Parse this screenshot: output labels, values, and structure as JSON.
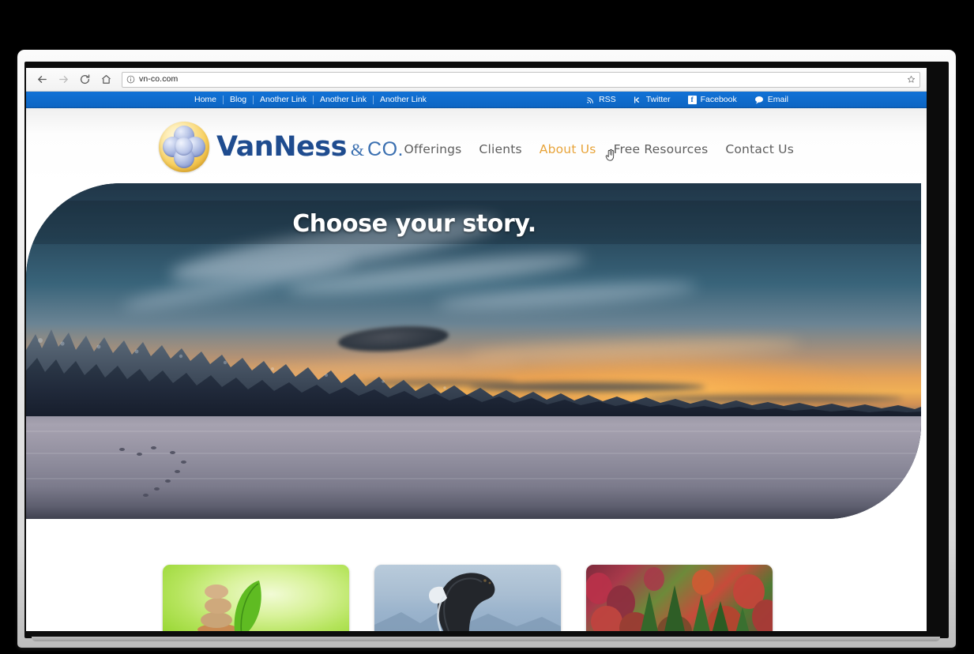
{
  "browser": {
    "url": "vn-co.com",
    "url_placeholder": "Search Google or type a URL",
    "controls": [
      {
        "name": "back",
        "icon": "arrow-left-icon",
        "enabled": true
      },
      {
        "name": "forward",
        "icon": "arrow-right-icon",
        "enabled": false
      },
      {
        "name": "reload",
        "icon": "reload-icon",
        "enabled": true
      },
      {
        "name": "home",
        "icon": "home-icon",
        "enabled": true
      }
    ],
    "info_icon": "info-circle-icon",
    "bookmark_icon": "star-icon"
  },
  "utility_bar": {
    "background": "#0d66c4",
    "links": [
      "Home",
      "Blog",
      "Another Link",
      "Another Link",
      "Another Link"
    ],
    "social": [
      {
        "label": "RSS",
        "icon": "rss-icon"
      },
      {
        "label": "Twitter",
        "icon": "twitter-icon"
      },
      {
        "label": "Facebook",
        "icon": "facebook-icon"
      },
      {
        "label": "Email",
        "icon": "email-icon"
      }
    ]
  },
  "header": {
    "logo": {
      "icon": "van-ness-spheres-logo",
      "brand_strong": "VanNess",
      "brand_amp": "&",
      "brand_co": "CO."
    },
    "nav": [
      {
        "label": "Offerings",
        "active": false
      },
      {
        "label": "Clients",
        "active": false
      },
      {
        "label": "About Us",
        "active": true
      },
      {
        "label": "Free Resources",
        "active": false
      },
      {
        "label": "Contact Us",
        "active": false
      }
    ],
    "active_color": "#e8a43a",
    "inactive_color": "#5e5e5e",
    "cursor": "hand-pointer-cursor"
  },
  "hero": {
    "headline": "Choose your story.",
    "image_alt": "winter-sunset-frozen-lake-photo"
  },
  "thumbnails": [
    {
      "alt": "zen-stones-leaf-photo",
      "name": "thumbnail-zen-stones"
    },
    {
      "alt": "breaching-whale-photo",
      "name": "thumbnail-whale"
    },
    {
      "alt": "autumn-forest-photo",
      "name": "thumbnail-autumn-forest"
    }
  ]
}
